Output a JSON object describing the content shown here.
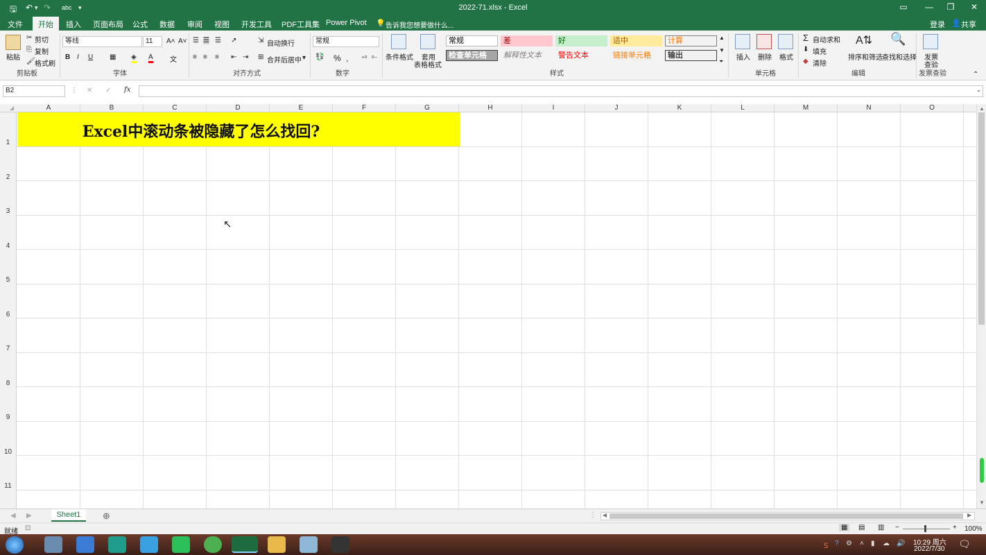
{
  "window": {
    "title": "2022-71.xlsx - Excel",
    "login": "登录",
    "share": "共享"
  },
  "qat": {
    "save": "🖫",
    "undo": "↶",
    "redo": "↷",
    "abc": "abc",
    "more": "▾"
  },
  "menu": {
    "tabs": [
      "文件",
      "开始",
      "插入",
      "页面布局",
      "公式",
      "数据",
      "审阅",
      "视图",
      "开发工具",
      "PDF工具集",
      "Power Pivot"
    ],
    "active": "开始",
    "tell_me": "告诉我您想要做什么..."
  },
  "ribbon": {
    "clipboard": {
      "paste": "粘贴",
      "cut": "剪切",
      "copy": "复制",
      "format_painter": "格式刷",
      "group": "剪贴板"
    },
    "font": {
      "name": "等线",
      "size": "11",
      "bold": "B",
      "italic": "I",
      "underline": "U",
      "group": "字体"
    },
    "alignment": {
      "wrap": "自动换行",
      "merge": "合并后居中",
      "group": "对齐方式"
    },
    "number": {
      "format": "常规",
      "percent": "%",
      "comma": ",",
      "group": "数字"
    },
    "styles": {
      "cond_format": "条件格式",
      "table_format_1": "套用",
      "table_format_2": "表格格式",
      "group": "样式",
      "cells": [
        {
          "label": "常规",
          "bg": "#ffffff",
          "fg": "#000000",
          "border": "#bcbcbc"
        },
        {
          "label": "差",
          "bg": "#ffc7ce",
          "fg": "#9c0006",
          "border": "#ffc7ce"
        },
        {
          "label": "好",
          "bg": "#c6efce",
          "fg": "#006100",
          "border": "#c6efce"
        },
        {
          "label": "适中",
          "bg": "#ffeb9c",
          "fg": "#9c5700",
          "border": "#ffeb9c"
        },
        {
          "label": "计算",
          "bg": "#f2f2f2",
          "fg": "#fa7d00",
          "border": "#7f7f7f"
        },
        {
          "label": "检查单元格",
          "bg": "#a5a5a5",
          "fg": "#ffffff",
          "border": "#3f3f3f"
        },
        {
          "label": "解释性文本",
          "bg": "#f3f3f3",
          "fg": "#7f7f7f",
          "border": "#f3f3f3"
        },
        {
          "label": "警告文本",
          "bg": "#f3f3f3",
          "fg": "#ff0000",
          "border": "#f3f3f3"
        },
        {
          "label": "链接单元格",
          "bg": "#f3f3f3",
          "fg": "#fa7d00",
          "border": "#f3f3f3"
        },
        {
          "label": "输出",
          "bg": "#f2f2f2",
          "fg": "#3f3f3f",
          "border": "#3f3f3f"
        }
      ]
    },
    "cells": {
      "insert": "插入",
      "delete": "删除",
      "format": "格式",
      "group": "单元格"
    },
    "editing": {
      "autosum": "自动求和",
      "fill": "填充",
      "clear": "清除",
      "sort": "排序和筛选",
      "find": "查找和选择",
      "group": "编辑"
    },
    "invoice": {
      "label1": "发票",
      "label2": "查验",
      "group": "发票查验"
    }
  },
  "formula_bar": {
    "name_box": "B2",
    "fx": "fx",
    "cancel": "✕",
    "enter": "✓",
    "value": ""
  },
  "grid": {
    "columns": [
      "A",
      "B",
      "C",
      "D",
      "E",
      "F",
      "G",
      "H",
      "I",
      "J",
      "K",
      "L",
      "M",
      "N",
      "O"
    ],
    "rows": [
      "1",
      "2",
      "3",
      "4",
      "5",
      "6",
      "7",
      "8",
      "9",
      "10",
      "11"
    ],
    "title_cell": {
      "text": "Excel中滚动条被隐藏了怎么找回?",
      "bg": "#ffff00"
    }
  },
  "sheets": {
    "tabs": [
      "Sheet1"
    ],
    "add": "⊕"
  },
  "status": {
    "ready": "就绪",
    "zoom": "100%",
    "minus": "−",
    "plus": "+"
  },
  "taskbar": {
    "time": "10:29 周六",
    "date": "2022/7/30"
  }
}
